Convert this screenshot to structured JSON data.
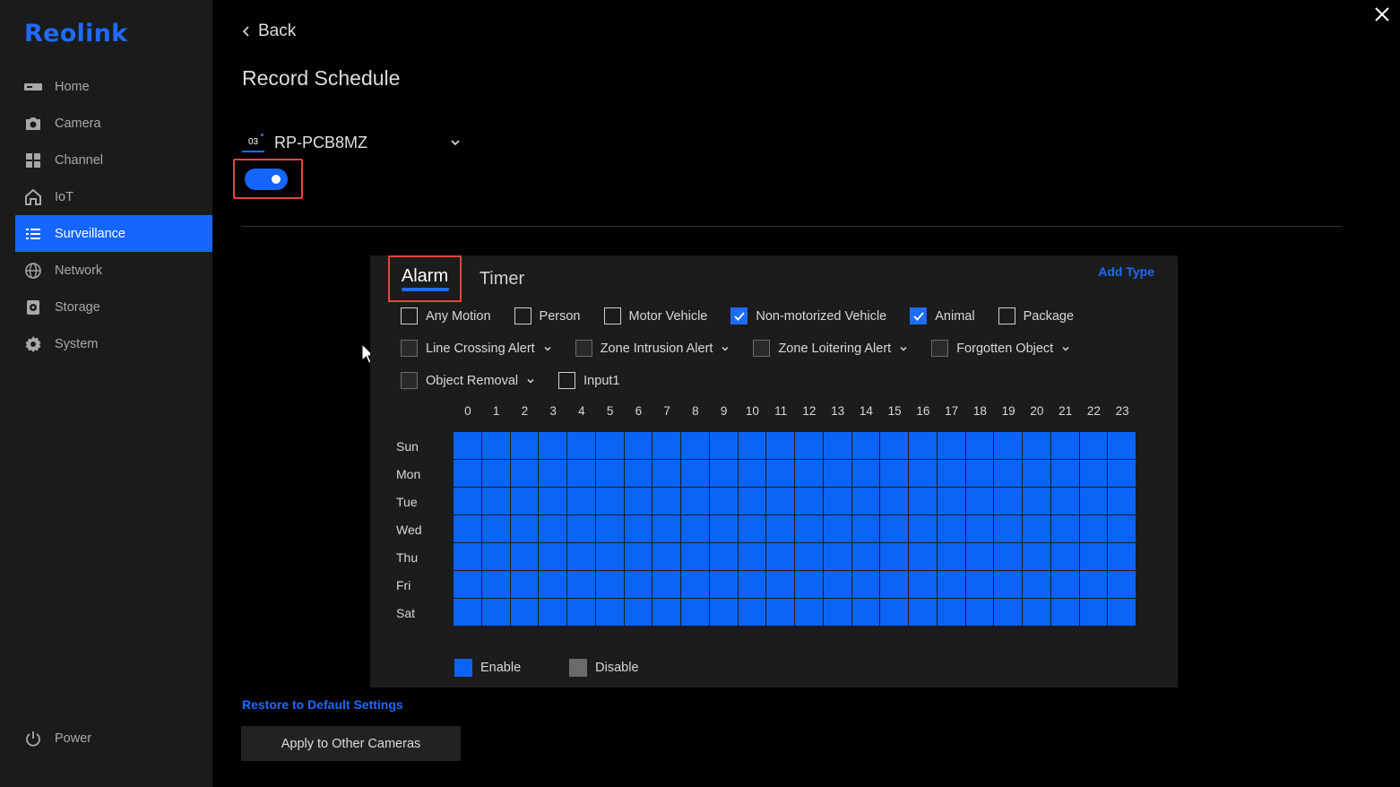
{
  "brand": "Reolink",
  "sidebar": {
    "items": [
      {
        "label": "Home",
        "icon": "nvr-icon"
      },
      {
        "label": "Camera",
        "icon": "camera-icon"
      },
      {
        "label": "Channel",
        "icon": "channel-grid-icon"
      },
      {
        "label": "IoT",
        "icon": "iot-home-icon"
      },
      {
        "label": "Surveillance",
        "icon": "list-icon",
        "active": true
      },
      {
        "label": "Network",
        "icon": "globe-icon"
      },
      {
        "label": "Storage",
        "icon": "storage-icon"
      },
      {
        "label": "System",
        "icon": "gear-icon"
      }
    ],
    "power_label": "Power"
  },
  "header": {
    "back_label": "Back",
    "title": "Record Schedule"
  },
  "camera": {
    "channel_number": "03",
    "name": "RP-PCB8MZ",
    "enabled": true
  },
  "tabs": {
    "alarm": "Alarm",
    "timer": "Timer",
    "active": "alarm",
    "add_type": "Add Type"
  },
  "alarm_types": {
    "row1": [
      {
        "label": "Any Motion",
        "checked": false
      },
      {
        "label": "Person",
        "checked": false
      },
      {
        "label": "Motor Vehicle",
        "checked": false
      },
      {
        "label": "Non-motorized Vehicle",
        "checked": true
      },
      {
        "label": "Animal",
        "checked": true
      },
      {
        "label": "Package",
        "checked": false
      }
    ],
    "row2": [
      {
        "label": "Line Crossing Alert",
        "checked": false
      },
      {
        "label": "Zone Intrusion Alert",
        "checked": false
      },
      {
        "label": "Zone Loitering Alert",
        "checked": false
      },
      {
        "label": "Forgotten Object",
        "checked": false
      }
    ],
    "row3": [
      {
        "label": "Object Removal",
        "checked": false
      },
      {
        "label": "Input1",
        "checked": false
      }
    ]
  },
  "schedule": {
    "hours": [
      "0",
      "1",
      "2",
      "3",
      "4",
      "5",
      "6",
      "7",
      "8",
      "9",
      "10",
      "11",
      "12",
      "13",
      "14",
      "15",
      "16",
      "17",
      "18",
      "19",
      "20",
      "21",
      "22",
      "23"
    ],
    "days": [
      "Sun",
      "Mon",
      "Tue",
      "Wed",
      "Thu",
      "Fri",
      "Sat"
    ],
    "all_enabled": true,
    "enable_color": "#0a63f5",
    "disable_color": "#6b6b6b"
  },
  "legend": {
    "enable": "Enable",
    "disable": "Disable"
  },
  "footer": {
    "restore": "Restore to Default Settings",
    "apply": "Apply to Other Cameras"
  }
}
